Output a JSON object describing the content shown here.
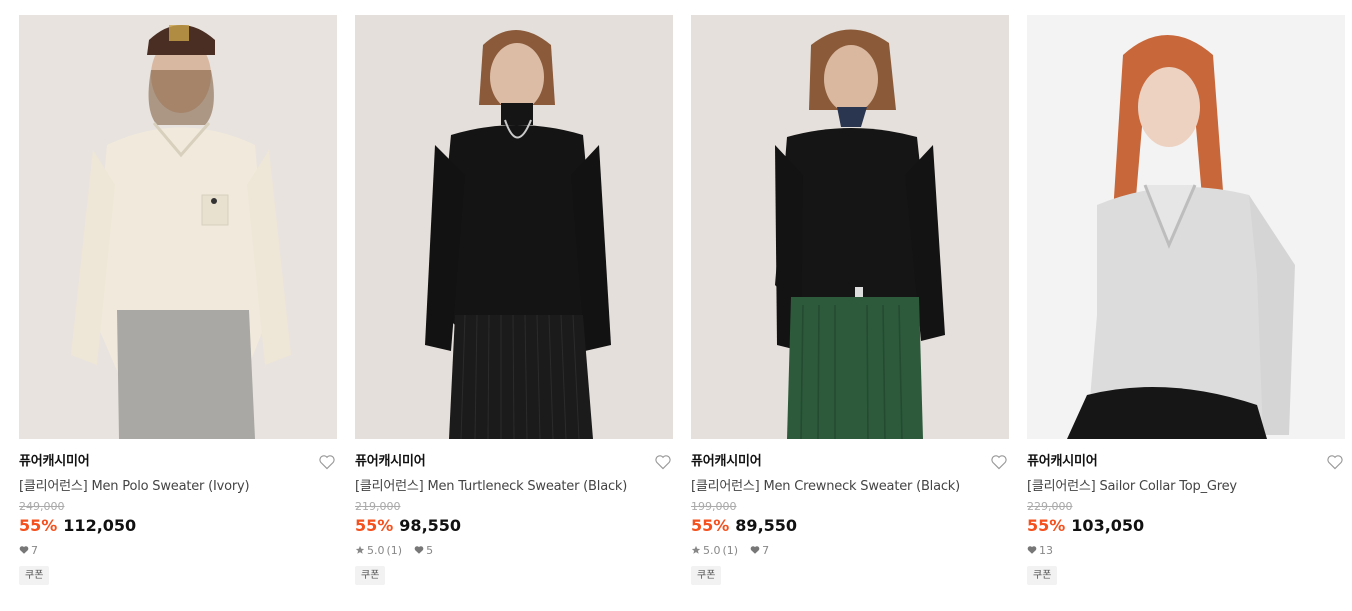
{
  "products": [
    {
      "brand": "퓨어캐시미어",
      "name": "[클리어런스] Men Polo Sweater (Ivory)",
      "original_price": "249,000",
      "discount": "55%",
      "price": "112,050",
      "rating": "",
      "reviews": "",
      "likes": "7",
      "coupon": "쿠폰",
      "image": "model wearing ivory polo sweater and grey trousers with brown cap"
    },
    {
      "brand": "퓨어캐시미어",
      "name": "[클리어런스] Men Turtleneck Sweater (Black)",
      "original_price": "219,000",
      "discount": "55%",
      "price": "98,550",
      "rating": "5.0",
      "reviews": "(1)",
      "likes": "5",
      "coupon": "쿠폰",
      "image": "model wearing black turtleneck sweater and pleated black skirt"
    },
    {
      "brand": "퓨어캐시미어",
      "name": "[클리어런스] Men Crewneck Sweater (Black)",
      "original_price": "199,000",
      "discount": "55%",
      "price": "89,550",
      "rating": "5.0",
      "reviews": "(1)",
      "likes": "7",
      "coupon": "쿠폰",
      "image": "model wearing black crewneck sweater and green corduroy trousers"
    },
    {
      "brand": "퓨어캐시미어",
      "name": "[클리어런스] Sailor Collar Top_Grey",
      "original_price": "229,000",
      "discount": "55%",
      "price": "103,050",
      "rating": "",
      "reviews": "",
      "likes": "13",
      "coupon": "쿠폰",
      "image": "red-haired model wearing grey sailor collar knit top"
    }
  ],
  "colors": {
    "discount": "#f4511e",
    "price": "#111111",
    "muted": "#888888",
    "background_photo": "#e6e1dc"
  }
}
